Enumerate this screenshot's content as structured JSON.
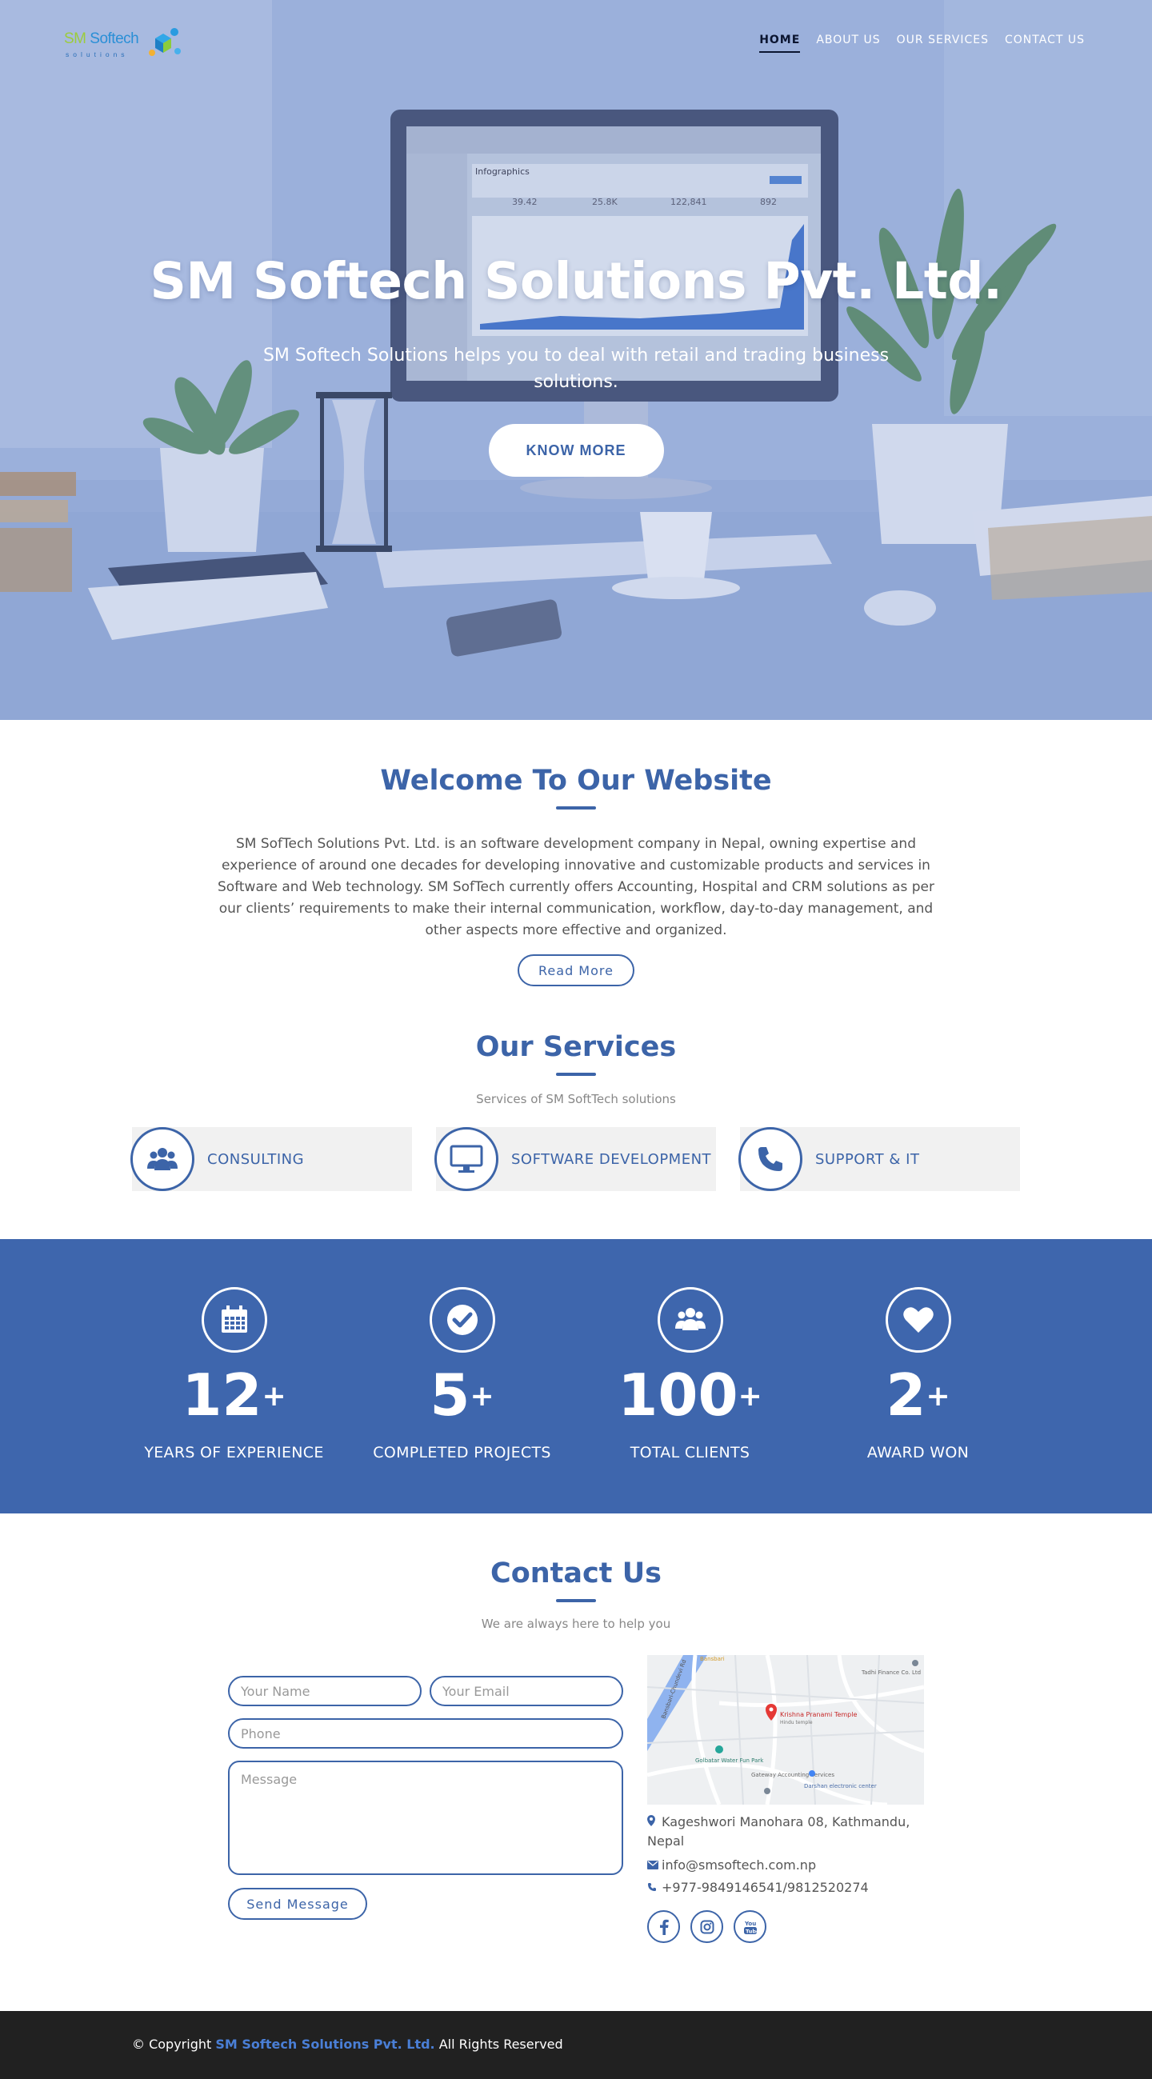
{
  "brand": {
    "logo_name_a": "SM",
    "logo_name_b": " Softech",
    "logo_sub": "solutions"
  },
  "nav": {
    "items": [
      {
        "label": "HOME"
      },
      {
        "label": "ABOUT US"
      },
      {
        "label": "OUR SERVICES"
      },
      {
        "label": "CONTACT US"
      }
    ],
    "active": "HOME"
  },
  "hero": {
    "title": "SM Softech Solutions Pvt. Ltd.",
    "subtitle": "SM Softech Solutions helps you to deal with retail and trading business solutions.",
    "button": "KNOW MORE",
    "monitor_title": "Infographics",
    "monitor_stats": [
      "39.42",
      "25.8K",
      "122,841",
      "892"
    ]
  },
  "welcome": {
    "title": "Welcome To Our Website",
    "text": "SM SofTech Solutions Pvt. Ltd. is an software development company in Nepal, owning expertise and experience of around one decades for developing innovative and customizable products and services in Software and Web technology. SM SofTech currently offers Accounting, Hospital and CRM solutions as per our clients’ requirements to make their internal communication, workflow, day-to-day management, and other aspects more effective and organized.",
    "button": "Read More"
  },
  "services": {
    "title": "Our Services",
    "subtitle": "Services of SM SoftTech solutions",
    "items": [
      {
        "label": "CONSULTING",
        "icon": "users-icon"
      },
      {
        "label": "SOFTWARE DEVELOPMENT",
        "icon": "monitor-icon"
      },
      {
        "label": "SUPPORT & IT",
        "icon": "phone-icon"
      }
    ]
  },
  "stats": {
    "items": [
      {
        "value": "12",
        "suffix": "+",
        "label": "YEARS OF EXPERIENCE",
        "icon": "calendar-icon"
      },
      {
        "value": "5",
        "suffix": "+",
        "label": "COMPLETED PROJECTS",
        "icon": "check-icon"
      },
      {
        "value": "100",
        "suffix": "+",
        "label": "TOTAL CLIENTS",
        "icon": "users-icon"
      },
      {
        "value": "2",
        "suffix": "+",
        "label": "AWARD WON",
        "icon": "heart-icon"
      }
    ]
  },
  "contact": {
    "title": "Contact Us",
    "subtitle": "We are always here to help you",
    "placeholders": {
      "name": "Your Name",
      "email": "Your Email",
      "phone": "Phone",
      "message": "Message"
    },
    "send_button": "Send Message",
    "map_labels": {
      "temple": "Krishna Pranami Temple",
      "temple_sub": "Hindu temple",
      "park": "Golbatar Water Fun Park",
      "accounting": "Gateway Accounting Services",
      "electronic": "Darshan electronic center",
      "finance": "Tadhi Finance Co. Ltd",
      "road": "Bansbari-Chundevi Rd",
      "top_label": "Bansbari"
    },
    "address": "Kageshwori Manohara 08, Kathmandu, Nepal",
    "email": "info@smsoftech.com.np",
    "phone": "+977-9849146541/9812520274",
    "social": [
      "facebook-icon",
      "instagram-icon",
      "youtube-icon"
    ]
  },
  "footer": {
    "prefix": "© Copyright ",
    "brand": "SM Softech Solutions Pvt. Ltd.",
    "suffix": " All Rights Reserved"
  },
  "colors": {
    "primary": "#3c64a8",
    "stats_bg": "#3e66ad",
    "footer_bg": "#212121",
    "card_bg": "#f1f1f1"
  }
}
